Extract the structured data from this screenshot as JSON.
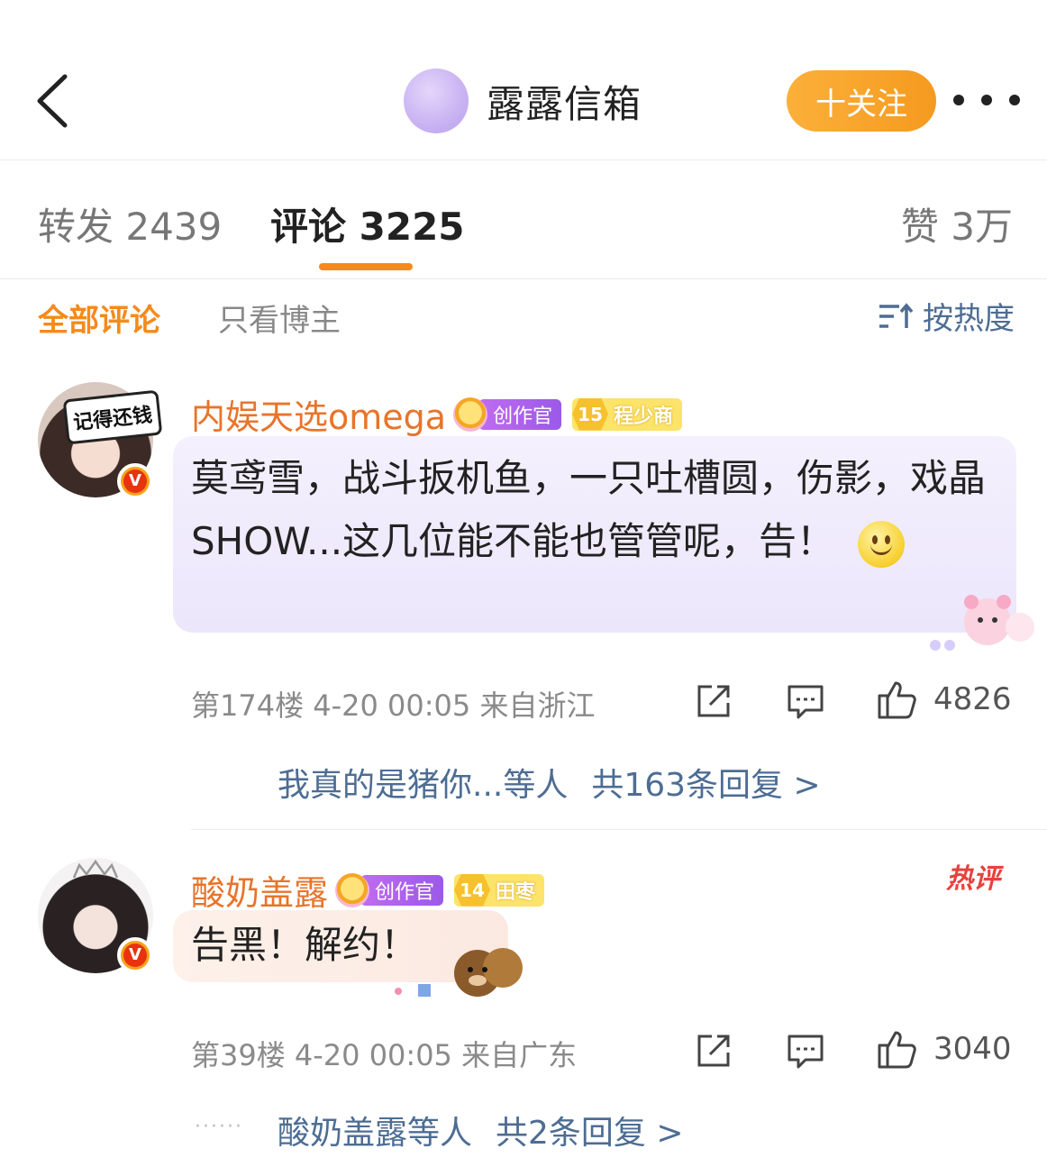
{
  "header": {
    "title": "露露信箱",
    "follow_label": "十关注"
  },
  "tabs": {
    "repost": "转发 2439",
    "comment": "评论 3225",
    "like": "赞 3万"
  },
  "filter": {
    "all": "全部评论",
    "owner_only": "只看博主",
    "sort": "按热度"
  },
  "comments": [
    {
      "avatar_sign": "记得还钱",
      "username": "内娱天选omega",
      "creator_badge": "创作官",
      "fan_level": "15",
      "fan_name": "程少商",
      "text": "莫鸢雪，战斗扳机鱼，一只吐槽圆，伤影，戏晶SHOW...这几位能不能也管管呢，告！",
      "meta": "第174楼 4-20 00:05 来自浙江",
      "likes": "4826",
      "reply_users": "我真的是猪你...等人",
      "reply_total": "共163条回复 >"
    },
    {
      "username": "酸奶盖露",
      "creator_badge": "创作官",
      "fan_level": "14",
      "fan_name": "田枣",
      "hot_tag": "热评",
      "text": "告黑！解约！",
      "meta": "第39楼 4-20 00:05 来自广东",
      "likes": "3040",
      "reply_users": "酸奶盖露等人",
      "reply_total": "共2条回复 >"
    }
  ],
  "colors": {
    "accent": "#f58a1b",
    "username": "#e8742a",
    "link": "#4d6d93",
    "follow_bg": "#f7a024"
  },
  "icons": [
    "back-arrow-icon",
    "more-dots-icon",
    "sort-icon",
    "share-icon",
    "comment-icon",
    "thumbs-up-icon",
    "verified-v-icon",
    "smiley-emoji-icon"
  ]
}
